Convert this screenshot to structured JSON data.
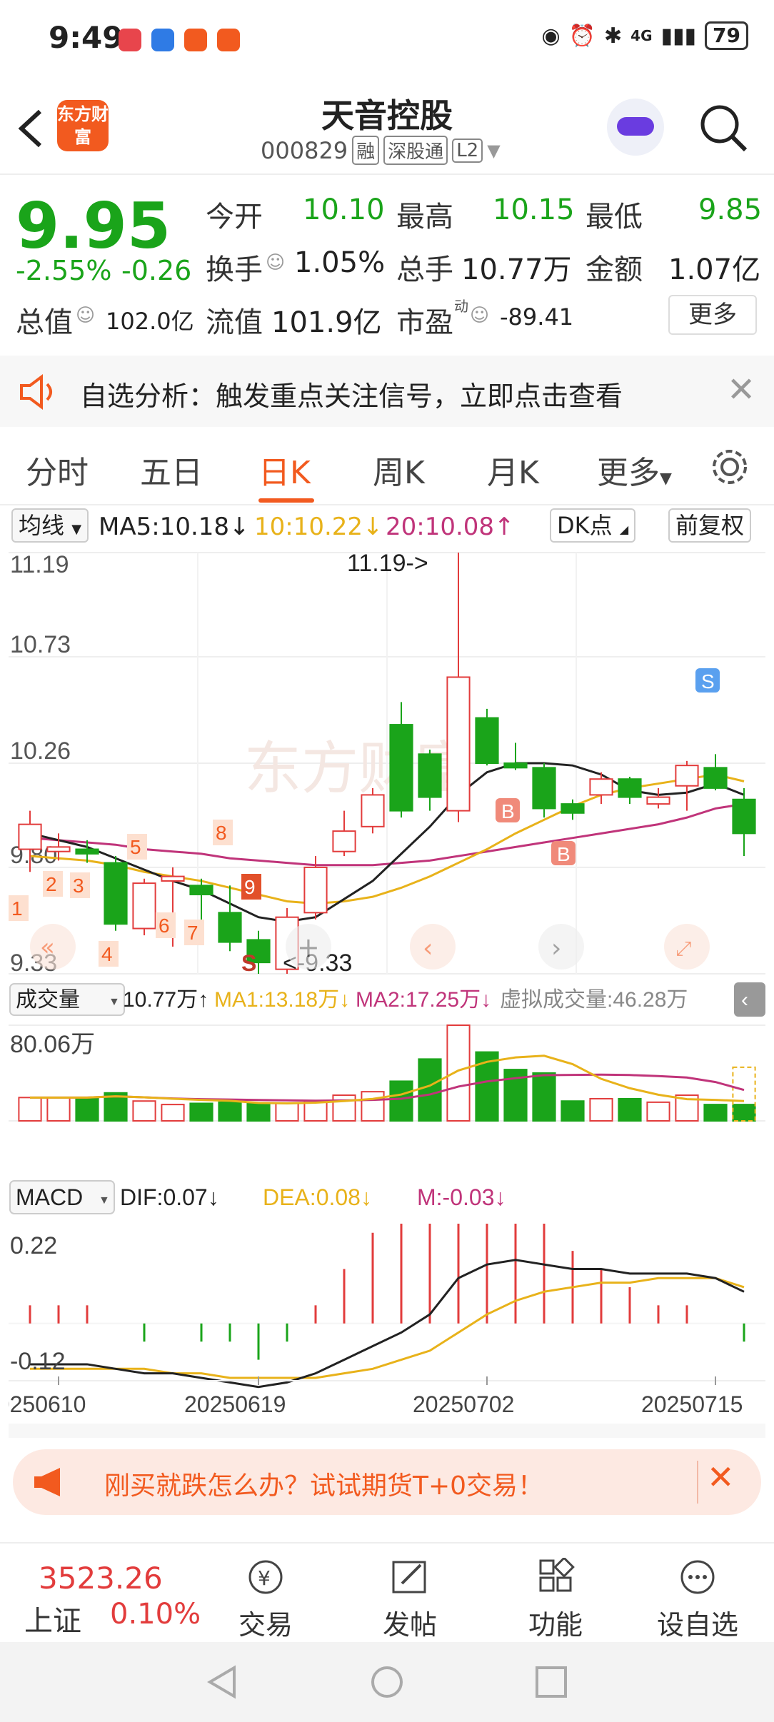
{
  "status": {
    "time": "9:49",
    "battery": "79",
    "signal": "4G"
  },
  "header": {
    "name": "天音控股",
    "code": "000829",
    "tags": [
      "融",
      "深股通",
      "L2"
    ],
    "logo_text": "东方财富"
  },
  "quote": {
    "price": "9.95",
    "pct": "-2.55%",
    "chg": "-0.26",
    "open_label": "今开",
    "open": "10.10",
    "high_label": "最高",
    "high": "10.15",
    "low_label": "最低",
    "low": "9.85",
    "turnover_label": "换手",
    "turnover": "1.05%",
    "volume_label": "总手",
    "volume": "10.77万",
    "amount_label": "金额",
    "amount": "1.07亿",
    "mcap_label": "总值",
    "mcap": "102.0亿",
    "float_label": "流值",
    "float": "101.9亿",
    "pe_label": "市盈",
    "pe_sup": "动",
    "pe": "-89.41",
    "more": "更多"
  },
  "banner": {
    "text": "自选分析：触发重点关注信号，立即点击查看"
  },
  "tabs": [
    "分时",
    "五日",
    "日K",
    "周K",
    "月K",
    "更多"
  ],
  "active_tab": "日K",
  "indicators": {
    "ma_select": "均线",
    "ma5": "MA5:10.18↓",
    "ma10": "10:10.22↓",
    "ma20": "20:10.08↑",
    "dk": "DK点",
    "fq": "前复权",
    "vol_select": "成交量",
    "vol": "10.77万↑",
    "vma1": "MA1:13.18万↓",
    "vma2": "MA2:17.25万↓",
    "vvirt": "虚拟成交量:46.28万",
    "macd_select": "MACD",
    "dif": "DIF:0.07↓",
    "dea": "DEA:0.08↓",
    "m": "M:-0.03↓"
  },
  "chart_data": {
    "type": "candlestick",
    "price_axis": {
      "labels": [
        "11.19",
        "10.73",
        "10.26",
        "9.80",
        "9.33"
      ]
    },
    "annotations": {
      "high": "11.19->",
      "low": "<-9.33"
    },
    "candles": [
      {
        "o": 9.88,
        "c": 9.99,
        "h": 10.05,
        "l": 9.78
      },
      {
        "o": 9.87,
        "c": 9.89,
        "h": 9.95,
        "l": 9.83
      },
      {
        "o": 9.88,
        "c": 9.86,
        "h": 9.92,
        "l": 9.82
      },
      {
        "o": 9.82,
        "c": 9.55,
        "h": 9.85,
        "l": 9.52
      },
      {
        "o": 9.53,
        "c": 9.73,
        "h": 9.75,
        "l": 9.5
      },
      {
        "o": 9.74,
        "c": 9.76,
        "h": 9.8,
        "l": 9.45
      },
      {
        "o": 9.72,
        "c": 9.68,
        "h": 9.75,
        "l": 9.55
      },
      {
        "o": 9.6,
        "c": 9.47,
        "h": 9.72,
        "l": 9.43
      },
      {
        "o": 9.48,
        "c": 9.38,
        "h": 9.52,
        "l": 9.33
      },
      {
        "o": 9.35,
        "c": 9.58,
        "h": 9.62,
        "l": 9.33
      },
      {
        "o": 9.6,
        "c": 9.8,
        "h": 9.85,
        "l": 9.57
      },
      {
        "o": 9.87,
        "c": 9.96,
        "h": 10.05,
        "l": 9.85
      },
      {
        "o": 9.98,
        "c": 10.12,
        "h": 10.15,
        "l": 9.95
      },
      {
        "o": 10.43,
        "c": 10.05,
        "h": 10.53,
        "l": 10.02
      },
      {
        "o": 10.3,
        "c": 10.11,
        "h": 10.32,
        "l": 10.05
      },
      {
        "o": 10.05,
        "c": 10.64,
        "h": 11.19,
        "l": 10.0
      },
      {
        "o": 10.46,
        "c": 10.26,
        "h": 10.5,
        "l": 10.25
      },
      {
        "o": 10.26,
        "c": 10.24,
        "h": 10.35,
        "l": 10.23
      },
      {
        "o": 10.24,
        "c": 10.06,
        "h": 10.26,
        "l": 10.02
      },
      {
        "o": 10.08,
        "c": 10.04,
        "h": 10.1,
        "l": 10.01
      },
      {
        "o": 10.12,
        "c": 10.19,
        "h": 10.22,
        "l": 10.08
      },
      {
        "o": 10.19,
        "c": 10.11,
        "h": 10.2,
        "l": 10.08
      },
      {
        "o": 10.08,
        "c": 10.11,
        "h": 10.15,
        "l": 10.06
      },
      {
        "o": 10.16,
        "c": 10.25,
        "h": 10.27,
        "l": 10.05
      },
      {
        "o": 10.24,
        "c": 10.15,
        "h": 10.3,
        "l": 10.14
      },
      {
        "o": 10.1,
        "c": 9.95,
        "h": 10.15,
        "l": 9.85
      }
    ],
    "ma5": [
      9.95,
      9.92,
      9.89,
      9.84,
      9.79,
      9.74,
      9.7,
      9.64,
      9.58,
      9.56,
      9.58,
      9.66,
      9.74,
      9.86,
      9.98,
      10.12,
      10.22,
      10.26,
      10.26,
      10.25,
      10.21,
      10.14,
      10.12,
      10.13,
      10.17,
      10.12
    ],
    "ma10": [
      9.85,
      9.84,
      9.83,
      9.81,
      9.78,
      9.76,
      9.74,
      9.71,
      9.68,
      9.65,
      9.64,
      9.65,
      9.67,
      9.71,
      9.76,
      9.82,
      9.88,
      9.95,
      10.01,
      10.07,
      10.12,
      10.15,
      10.17,
      10.19,
      10.21,
      10.18
    ],
    "ma20": [
      9.93,
      9.92,
      9.91,
      9.9,
      9.88,
      9.87,
      9.86,
      9.84,
      9.83,
      9.82,
      9.81,
      9.81,
      9.81,
      9.82,
      9.83,
      9.85,
      9.87,
      9.89,
      9.91,
      9.93,
      9.95,
      9.97,
      9.99,
      10.02,
      10.06,
      10.08
    ],
    "volume": [
      2,
      2,
      2,
      2.4,
      1.7,
      1.4,
      1.5,
      1.6,
      1.5,
      1.5,
      1.7,
      2.2,
      2.5,
      3.4,
      5.3,
      8.2,
      5.9,
      4.4,
      4.1,
      1.7,
      1.9,
      1.9,
      1.6,
      2.2,
      1.4,
      1.4
    ],
    "vol_axis_label": "80.06万",
    "macd": {
      "labels": [
        "0.22",
        "-0.12"
      ]
    },
    "dates": [
      "20250610",
      "20250619",
      "20250702",
      "20250715"
    ]
  },
  "bottom_ad": {
    "text": "刚买就跌怎么办？试试期货T+0交易！"
  },
  "bottom_nav": {
    "index_value": "3523.26",
    "index_name": "上证",
    "index_pct": "0.10%",
    "items": [
      "交易",
      "发帖",
      "功能",
      "设自选"
    ]
  },
  "colors": {
    "up": "#e23c3c",
    "down": "#1aa41a",
    "accent": "#f25a1f"
  }
}
